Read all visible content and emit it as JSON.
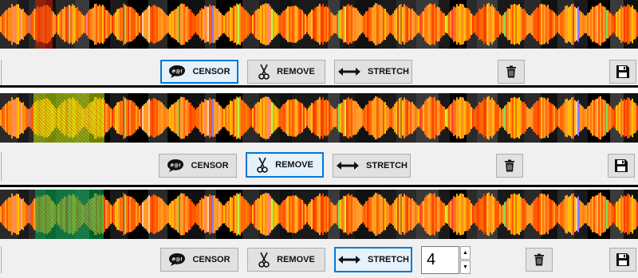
{
  "buttons": {
    "censor_label": "CENSOR",
    "remove_label": "REMOVE",
    "stretch_label": "STRETCH"
  },
  "panels": [
    {
      "active_tool": "censor",
      "selection": "none"
    },
    {
      "active_tool": "remove",
      "selection_color": "#d7ff00"
    },
    {
      "active_tool": "stretch",
      "selection_color": "#00c060"
    }
  ],
  "stretch_factor": "4",
  "colors": {
    "active_border": "#0078d7",
    "toolbar_bg": "#f0f0f0",
    "wave_orange": "#ff6a00",
    "wave_red": "#ff3000",
    "wave_yellow": "#ffc000"
  },
  "icons": {
    "censor": "speech-bubble-censor-icon",
    "remove": "scissors-icon",
    "stretch": "double-arrow-icon",
    "delete": "trash-icon",
    "save": "floppy-disk-icon"
  }
}
